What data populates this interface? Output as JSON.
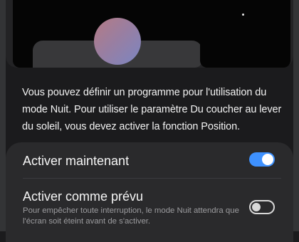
{
  "description": "Vous pouvez définir un programme pour l'utilisation du mode Nuit. Pour utiliser le paramètre Du coucher au lever du soleil, vous devez activer la fonction Position.",
  "settings": {
    "activate_now": {
      "label": "Activer maintenant",
      "state": "on"
    },
    "activate_scheduled": {
      "label": "Activer comme prévu",
      "subtitle": "Pour empêcher toute interruption, le mode Nuit attendra que l'écran soit éteint avant de s'activer.",
      "state": "off"
    }
  },
  "colors": {
    "background": "#1b1b1d",
    "card": "#2a2a2c",
    "toggle_on": "#3e91ff",
    "preview_circle": [
      "#b57b84",
      "#7b86c2"
    ]
  }
}
